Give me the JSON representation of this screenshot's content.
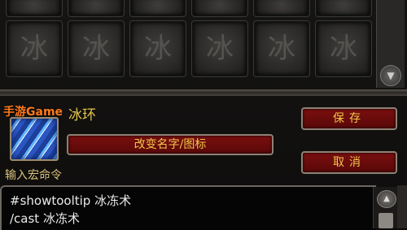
{
  "watermark": "手游Game",
  "macro": {
    "name": "冰环",
    "rename_label": "改变名字/图标",
    "save_label": "保存",
    "cancel_label": "取消",
    "enter_label": "输入宏命令",
    "lines": [
      "#showtooltip 冰冻术",
      "/cast 冰冻术"
    ]
  },
  "grid": {
    "slot_glyph": "冰",
    "slot_icon": "frost-rune-icon"
  },
  "colors": {
    "button_bg": "#7a0f0f",
    "button_text": "#f2c74a",
    "macro_name": "#e6c547",
    "watermark": "#ff7a1a"
  }
}
